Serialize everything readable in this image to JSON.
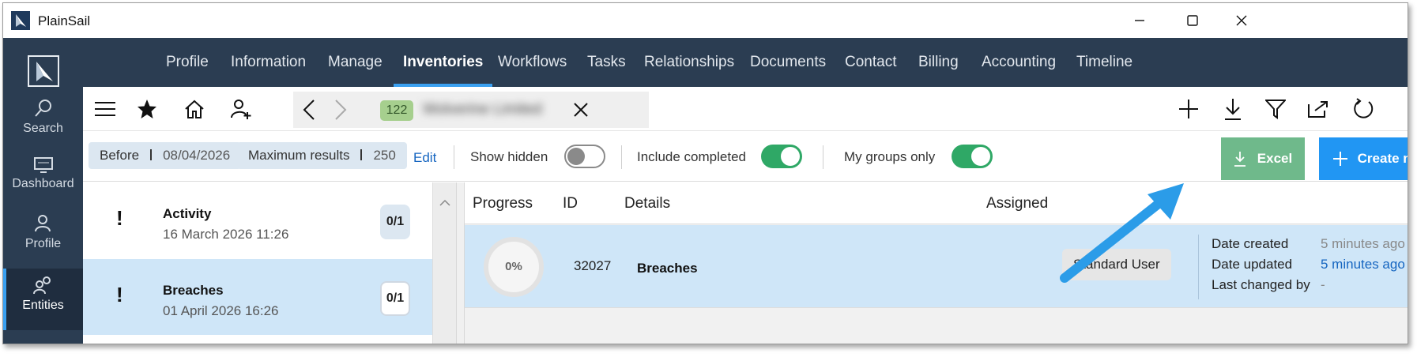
{
  "window": {
    "title": "PlainSail"
  },
  "nav_tabs": [
    "Profile",
    "Information",
    "Manage",
    "Inventories",
    "Workflows",
    "Tasks",
    "Relationships",
    "Documents",
    "Contact",
    "Billing",
    "Accounting",
    "Timeline"
  ],
  "active_tab": "Inventories",
  "rail": {
    "search": "Search",
    "dashboard": "Dashboard",
    "profile": "Profile",
    "entities": "Entities"
  },
  "entity_tab": {
    "count": "122",
    "name": "Wolverine Limited"
  },
  "filters": {
    "before_label": "Before",
    "before_value": "08/04/2026",
    "max_label": "Maximum results",
    "max_value": "250",
    "edit": "Edit",
    "show_hidden": "Show hidden",
    "show_hidden_on": false,
    "include_completed": "Include completed",
    "include_completed_on": true,
    "my_groups_only": "My groups only",
    "my_groups_only_on": true
  },
  "buttons": {
    "excel": "Excel",
    "create_new": "Create new"
  },
  "list": [
    {
      "title": "Activity",
      "date": "16 March 2026 11:26",
      "fraction": "0/1"
    },
    {
      "title": "Breaches",
      "date": "01 April 2026 16:26",
      "fraction": "0/1"
    }
  ],
  "table": {
    "headers": {
      "progress": "Progress",
      "id": "ID",
      "details": "Details",
      "assigned": "Assigned"
    },
    "row": {
      "progress": "0%",
      "id": "32027",
      "details": "Breaches",
      "assigned": "Standard User",
      "date_created_label": "Date created",
      "date_created": "5 minutes ago",
      "date_updated_label": "Date updated",
      "date_updated": "5 minutes ago",
      "last_changed_label": "Last changed by",
      "last_changed": "-"
    }
  },
  "colors": {
    "nav_bg": "#2b3d52",
    "accent": "#3aa0f0",
    "excel": "#6fb98b",
    "create": "#2196f3",
    "toggle_on": "#2fa866",
    "selected_row": "#cfe6f8"
  }
}
